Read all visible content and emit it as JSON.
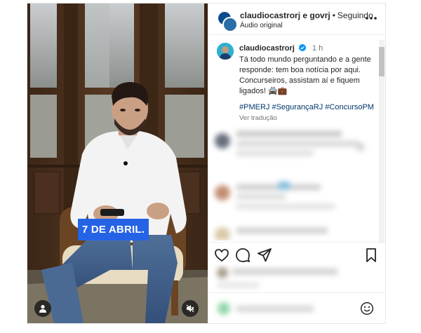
{
  "header": {
    "title": "claudiocastrorj e govrj",
    "separator": "•",
    "follow_label": "Seguindo",
    "subtitle": "Áudio original"
  },
  "post": {
    "username": "claudiocastrorj",
    "time": "1 h",
    "text": "Tá todo mundo perguntando e a gente responde: tem boa notícia por aqui. Concurseiros, assistam aí e fiquem ligados! 🚔💼",
    "hashtags": "#PMERJ #SegurançaRJ #ConcursoPM",
    "translate_label": "Ver tradução"
  },
  "video": {
    "caption": "7 DE ABRIL."
  },
  "icons": {
    "more": "more-horizontal-icon",
    "verified": "verified-badge-icon",
    "like": "heart-icon",
    "comment": "comment-bubble-icon",
    "share": "paper-plane-icon",
    "save": "bookmark-icon",
    "emoji": "smiley-icon",
    "user_tag": "user-icon",
    "mute": "muted-speaker-icon"
  },
  "colors": {
    "caption_bg": "#2563e6",
    "link": "#00376b",
    "verified": "#0095f6"
  }
}
